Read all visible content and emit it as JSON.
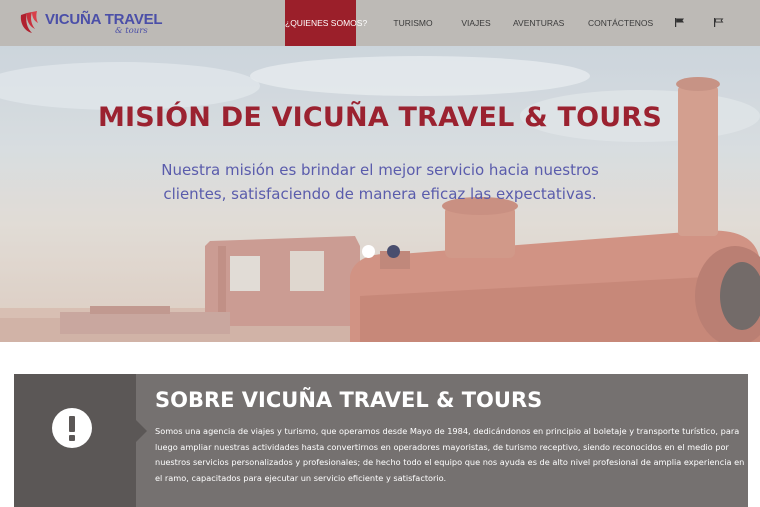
{
  "colors": {
    "brand": "#9b1f2a",
    "logo": "#4b4fa8",
    "header_bg": "#bdbab6",
    "about_bg": "#757170",
    "about_icon_bg": "#5b5756"
  },
  "logo": {
    "name": "VICUÑA TRAVEL",
    "sub": "& tours"
  },
  "nav": {
    "items": [
      {
        "label": "¿QUIENES SOMOS?",
        "active": true
      },
      {
        "label": "TURISMO",
        "active": false
      },
      {
        "label": "VIAJES",
        "active": false
      },
      {
        "label": "AVENTURAS",
        "active": false
      },
      {
        "label": "CONTÁCTENOS",
        "active": false
      }
    ],
    "flags": [
      "flag-es-icon",
      "flag-en-icon"
    ]
  },
  "hero": {
    "title": "MISIÓN DE VICUÑA TRAVEL & TOURS",
    "text": "Nuestra misión es brindar el mejor servicio hacia nuestros clientes, satisfaciendo de manera eficaz las expectativas.",
    "slides": 2,
    "active_slide": 1
  },
  "about": {
    "icon": "exclamation-circle-icon",
    "title": "SOBRE VICUÑA TRAVEL & TOURS",
    "text": "Somos una agencia de viajes y turismo, que operamos desde Mayo de 1984, dedicándonos en principio al boletaje y transporte turístico, para luego ampliar nuestras actividades hasta convertirnos en operadores mayoristas, de turismo receptivo, siendo reconocidos en el medio por nuestros servicios personalizados y profesionales; de hecho todo el equipo que nos ayuda es de alto nivel profesional de amplia experiencia en el ramo, capacitados para ejecutar un servicio eficiente y satisfactorio."
  }
}
